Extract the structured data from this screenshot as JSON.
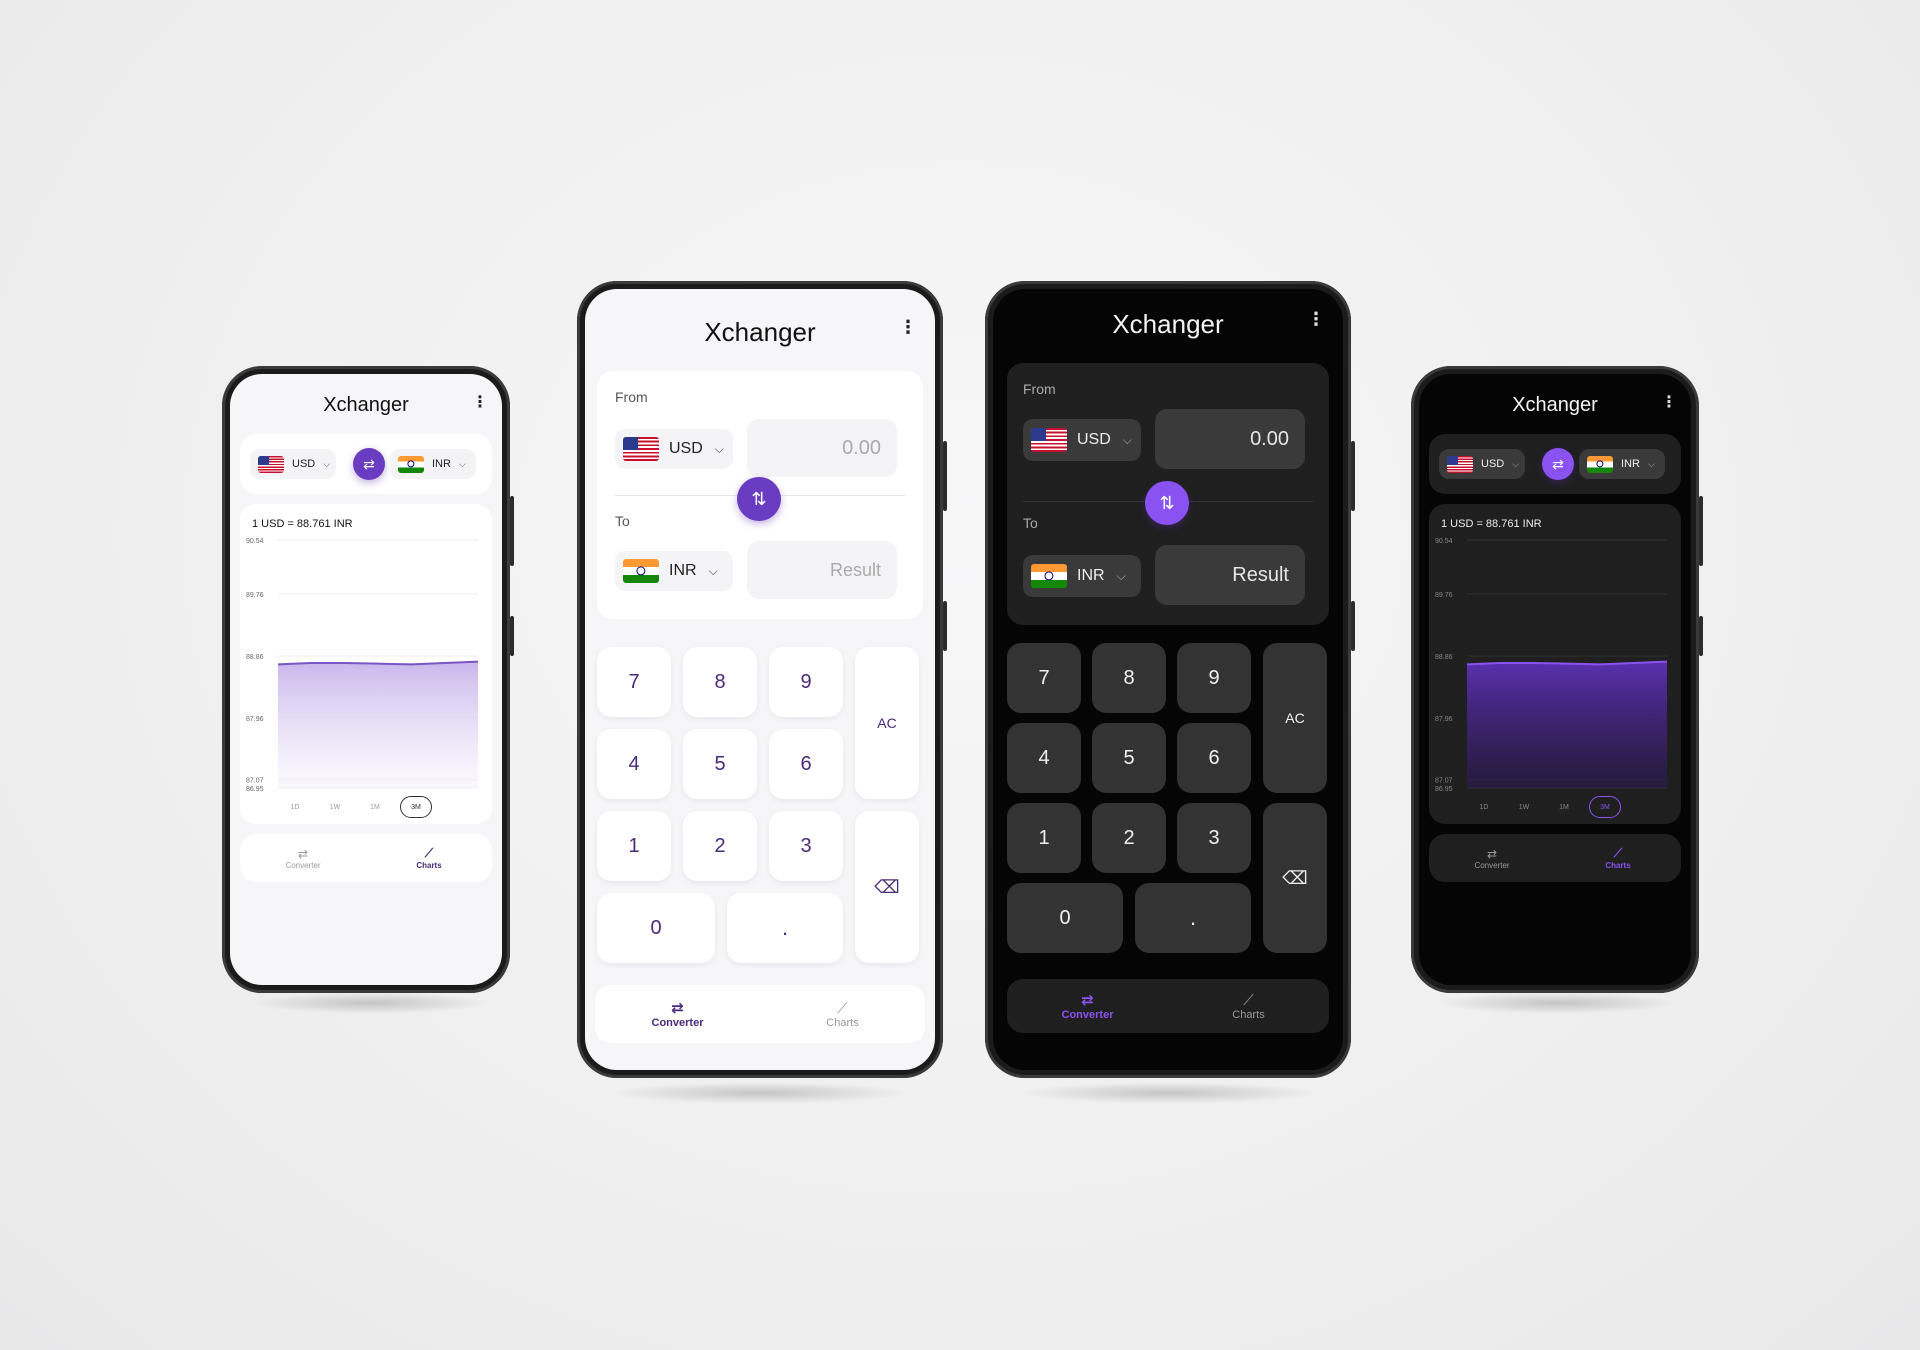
{
  "app": {
    "title": "Xchanger"
  },
  "converter": {
    "from_label": "From",
    "to_label": "To",
    "from_currency": "USD",
    "to_currency": "INR",
    "from_value_placeholder": "0.00",
    "to_value_placeholder": "Result",
    "keys": [
      "7",
      "8",
      "9",
      "4",
      "5",
      "6",
      "1",
      "2",
      "3",
      "0",
      "."
    ],
    "clear_label": "AC"
  },
  "charts": {
    "rate_text": "1 USD = 88.761 INR",
    "ranges": [
      "1D",
      "1W",
      "1M",
      "3M"
    ],
    "selected_range": "3M"
  },
  "nav": {
    "converter_label": "Converter",
    "charts_label": "Charts",
    "active_on_converter": "Converter",
    "active_on_charts": "Charts"
  },
  "colors": {
    "accent": "#6a3cc1",
    "accent_dark": "#8a52f0",
    "light_bg": "#f6f5f8",
    "dark_bg": "#050505"
  },
  "chart_data": {
    "type": "area",
    "y_ticks": [
      "90.54",
      "89.76",
      "88.86",
      "87.96",
      "87.07",
      "86.95"
    ],
    "ylim": [
      86.95,
      90.54
    ],
    "x": [
      0,
      1,
      2,
      3,
      4,
      5,
      6
    ],
    "values": [
      88.74,
      88.76,
      88.76,
      88.75,
      88.74,
      88.76,
      88.78
    ],
    "grid": true,
    "legend": "none"
  }
}
